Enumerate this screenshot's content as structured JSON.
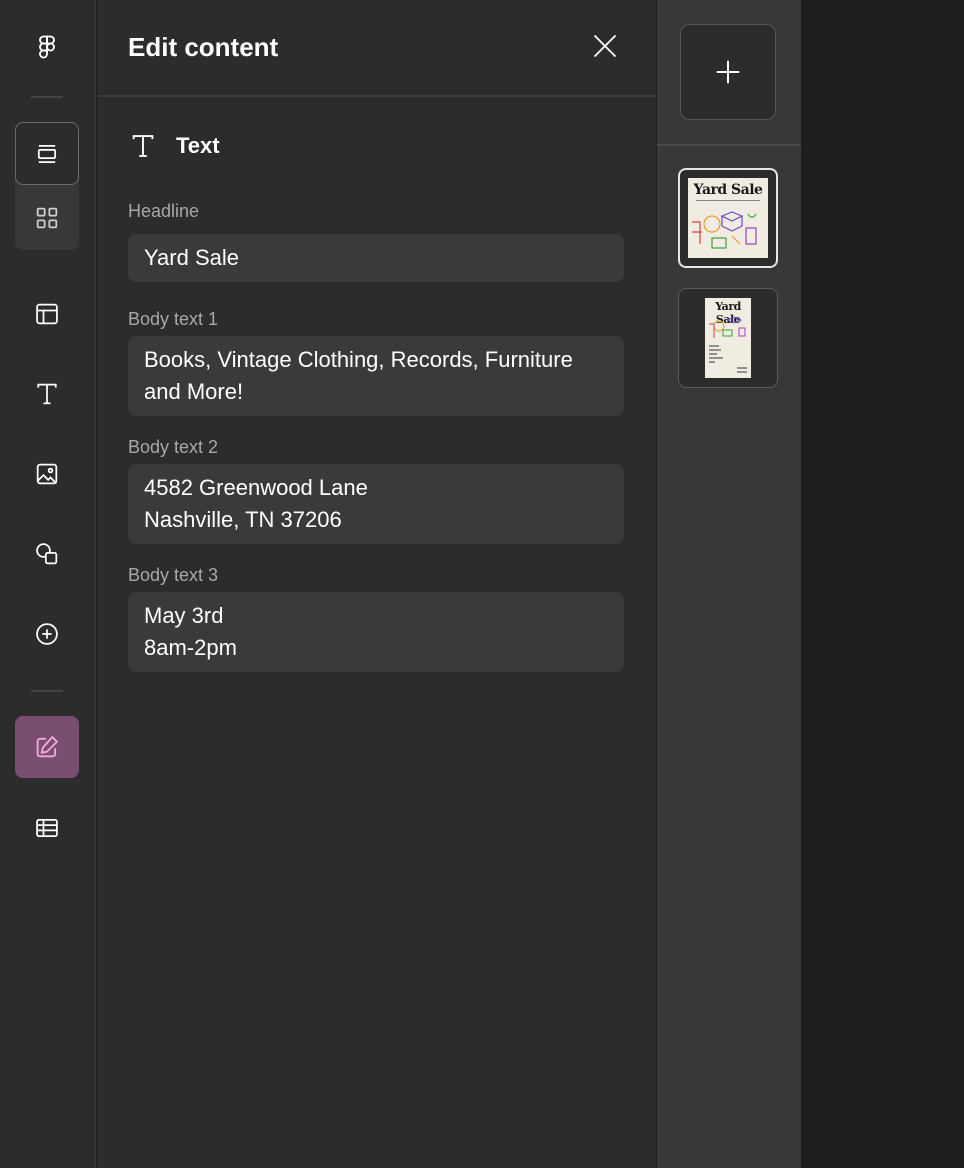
{
  "panel": {
    "title": "Edit content",
    "section_label": "Text",
    "fields": [
      {
        "label": "Headline",
        "lines": [
          "Yard Sale"
        ]
      },
      {
        "label": "Body text 1",
        "lines": [
          "Books, Vintage Clothing, Records, Furniture",
          "and More!"
        ]
      },
      {
        "label": "Body text 2",
        "lines": [
          "4582 Greenwood Lane",
          "Nashville, TN 37206"
        ]
      },
      {
        "label": "Body text 3",
        "lines": [
          "May 3rd",
          "8am-2pm"
        ]
      }
    ]
  },
  "pages": {
    "thumbnails": [
      {
        "title": "Yard Sale",
        "selected": true
      },
      {
        "title": "Yard Sale",
        "selected": false
      }
    ]
  },
  "colors": {
    "edit_accent": "#7a4e70",
    "icon_pink": "#f0a8e0"
  },
  "icons": {
    "logo": "figma-logo-icon",
    "close": "close-icon",
    "add": "plus-icon"
  }
}
